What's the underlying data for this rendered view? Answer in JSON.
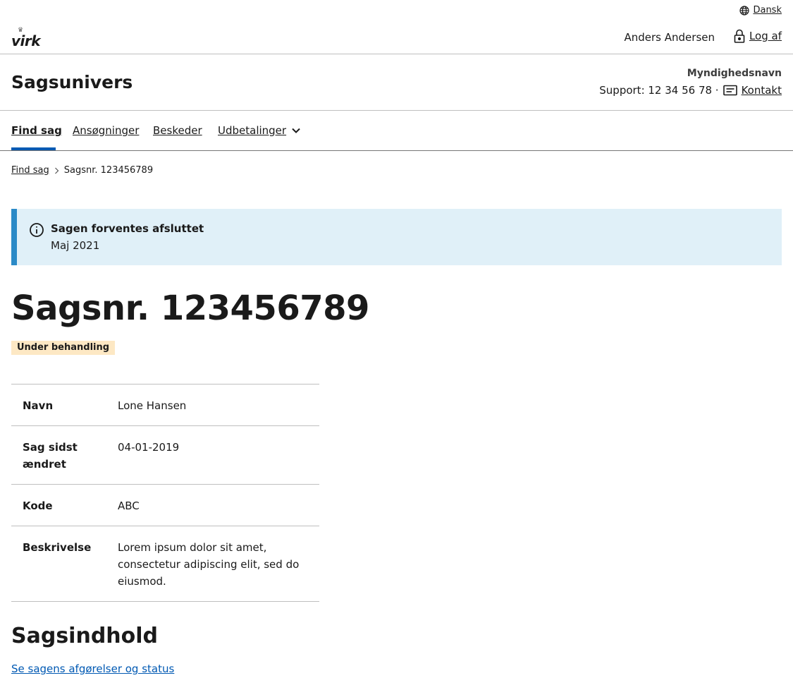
{
  "portal": {
    "language": "Dansk",
    "logo_text": "virk",
    "user_name": "Anders Andersen",
    "logout_label": "Log af"
  },
  "solution": {
    "title": "Sagsunivers",
    "authority": "Myndighedsnavn",
    "support_text": "Support: 12 34 56 78 ·",
    "contact_label": "Kontakt"
  },
  "nav": {
    "items": [
      {
        "label": "Find sag",
        "active": true
      },
      {
        "label": "Ansøgninger"
      },
      {
        "label": "Beskeder"
      },
      {
        "label": "Udbetalinger",
        "has_dropdown": true
      }
    ]
  },
  "breadcrumb": {
    "items": [
      "Find sag",
      "Sagsnr. 123456789"
    ]
  },
  "alert": {
    "heading": "Sagen forventes afsluttet",
    "text": "Maj 2021",
    "accent_color": "#2b8ac7"
  },
  "case": {
    "title": "Sagsnr. 123456789",
    "status": "Under behandling",
    "details": [
      {
        "label": "Navn",
        "value": "Lone Hansen"
      },
      {
        "label": "Sag sidst ændret",
        "value": "04-01-2019"
      },
      {
        "label": "Kode",
        "value": "ABC"
      },
      {
        "label": "Beskrivelse",
        "value": "Lorem ipsum dolor sit amet, consectetur adipiscing elit, sed do eiusmod."
      }
    ]
  },
  "content": {
    "heading": "Sagsindhold",
    "link": "Se sagens afgørelser og status"
  },
  "colors": {
    "link": "#0059b3",
    "nav_active": "#0059b3",
    "badge_bg": "#fde8c4",
    "alert_bg": "#e0f0f8"
  }
}
